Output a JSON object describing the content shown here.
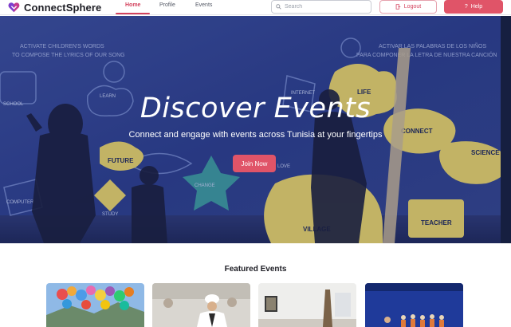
{
  "header": {
    "brand": "ConnectSphere",
    "nav": [
      "Home",
      "Profile",
      "Events"
    ],
    "search_placeholder": "Search",
    "logout_label": "Logout",
    "help_label": "Help"
  },
  "hero": {
    "title": "Discover Events",
    "subtitle": "Connect and engage with events across Tunisia at your fingertips",
    "join_label": "Join Now"
  },
  "featured": {
    "title": "Featured Events"
  },
  "colors": {
    "accent": "#e05468",
    "brand_text": "#1d1d24",
    "hero_blue": "#2a3e8f"
  }
}
